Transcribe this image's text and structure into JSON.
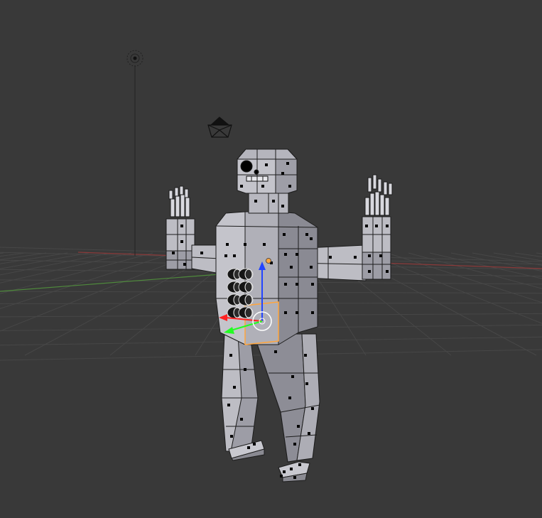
{
  "viewport": {
    "background": "#393939",
    "grid_color": "#474747",
    "x_axis_color": "#8a3a3a",
    "y_axis_color": "#4f8a3c",
    "camera_icon": "camera-icon",
    "lamp_icon": "lamp-icon"
  },
  "model": {
    "body_color": "#9d9da6",
    "body_light_color": "#bdbdc4",
    "body_dark_color": "#7f7f88",
    "edge_color": "#1c1c1c",
    "vertex_color": "#000000",
    "selected_face_color": "#ffa53d",
    "pivot_color": "#ffa53d"
  },
  "manipulator": {
    "x_color": "#ff2222",
    "y_color": "#22ff22",
    "z_color": "#2244ff",
    "widget": "transform-manipulator-icon"
  }
}
